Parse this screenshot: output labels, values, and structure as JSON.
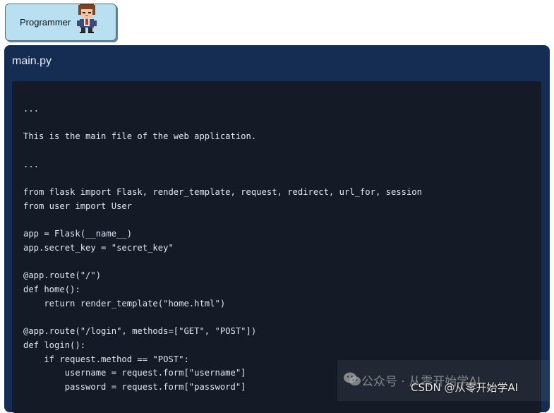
{
  "role": {
    "label": "Programmer",
    "avatar_icon": "programmer-avatar-icon"
  },
  "file": {
    "name": "main.py"
  },
  "code": {
    "text": "...\n\nThis is the main file of the web application.\n\n...\n\nfrom flask import Flask, render_template, request, redirect, url_for, session\nfrom user import User\n\napp = Flask(__name__)\napp.secret_key = \"secret_key\"\n\n@app.route(\"/\")\ndef home():\n    return render_template(\"home.html\")\n\n@app.route(\"/login\", methods=[\"GET\", \"POST\"])\ndef login():\n    if request.method == \"POST\":\n        username = request.form[\"username\"]\n        password = request.form[\"password\"]"
  },
  "watermark": {
    "line1": "公众号 · 从零开始学AI",
    "line2": "CSDN @从零开始学AI",
    "icon": "wechat-icon"
  },
  "colors": {
    "badge_bg": "#b9e0f1",
    "panel_bg": "#152d52",
    "code_bg": "#141b27",
    "code_text": "#e2e6ee"
  }
}
